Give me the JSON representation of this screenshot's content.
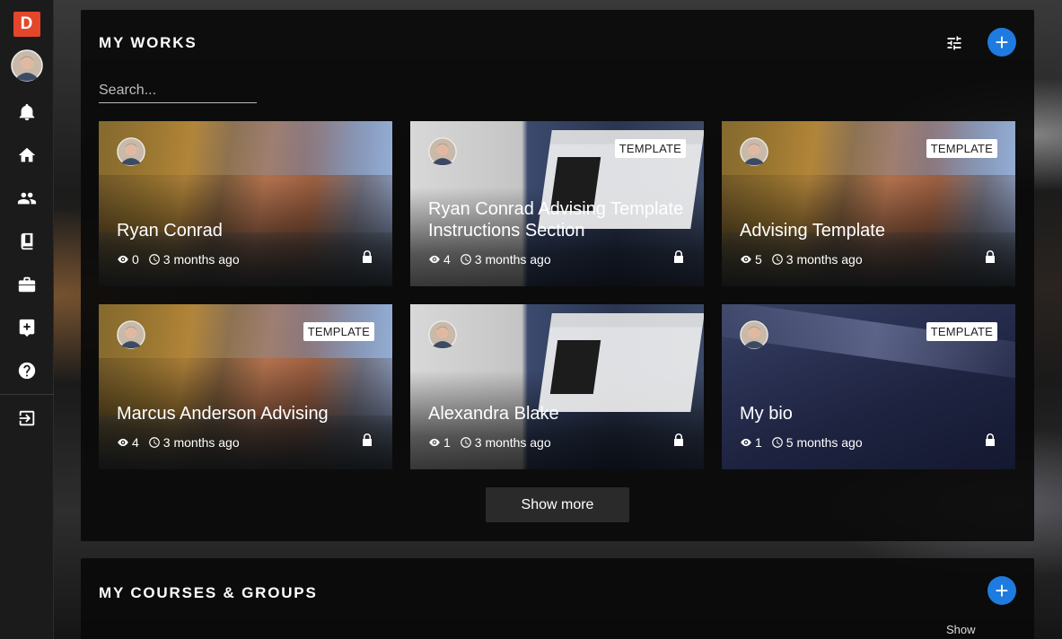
{
  "app": {
    "logo_letter": "D"
  },
  "sidebar": {
    "items": [
      {
        "name": "notifications",
        "icon": "bell-icon"
      },
      {
        "name": "home",
        "icon": "home-icon"
      },
      {
        "name": "people",
        "icon": "people-icon"
      },
      {
        "name": "library",
        "icon": "book-icon"
      },
      {
        "name": "portfolio",
        "icon": "briefcase-icon"
      },
      {
        "name": "add-content",
        "icon": "add-box-icon"
      },
      {
        "name": "help",
        "icon": "help-icon"
      },
      {
        "name": "logout",
        "icon": "logout-icon"
      }
    ]
  },
  "works": {
    "title": "MY WORKS",
    "search_placeholder": "Search...",
    "badge_label": "TEMPLATE",
    "show_more": "Show more",
    "cards": [
      {
        "title": "Ryan Conrad",
        "views": "0",
        "time": "3 months ago",
        "template": false,
        "bg": "bridge"
      },
      {
        "title": "Ryan Conrad Advising Template Instructions Section",
        "views": "4",
        "time": "3 months ago",
        "template": true,
        "bg": "laptop"
      },
      {
        "title": "Advising Template",
        "views": "5",
        "time": "3 months ago",
        "template": true,
        "bg": "bridge"
      },
      {
        "title": "Marcus Anderson Advising",
        "views": "4",
        "time": "3 months ago",
        "template": true,
        "bg": "bridge"
      },
      {
        "title": "Alexandra Blake",
        "views": "1",
        "time": "3 months ago",
        "template": false,
        "bg": "laptop"
      },
      {
        "title": "My bio",
        "views": "1",
        "time": "5 months ago",
        "template": true,
        "bg": "blue"
      }
    ]
  },
  "courses": {
    "title": "MY COURSES & GROUPS",
    "show_label": "Show"
  },
  "colors": {
    "accent": "#1e7be0",
    "logo": "#e3462b"
  }
}
